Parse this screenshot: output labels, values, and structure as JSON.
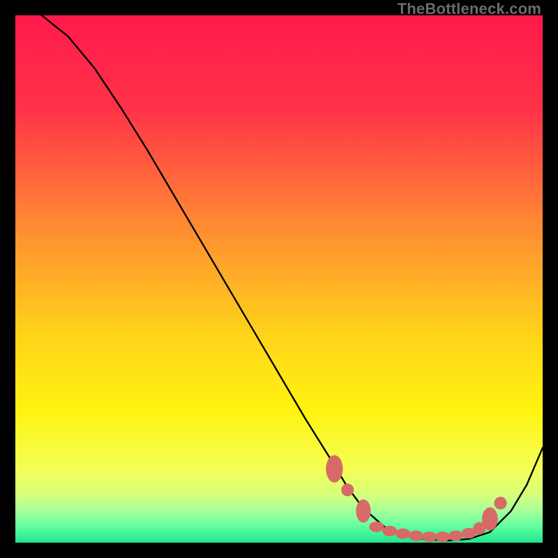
{
  "watermark": "TheBottleneck.com",
  "chart_data": {
    "type": "line",
    "title": "",
    "xlabel": "",
    "ylabel": "",
    "xlim": [
      0,
      100
    ],
    "ylim": [
      0,
      100
    ],
    "gradient_stops": [
      {
        "offset": 0,
        "color": "#ff1a4b"
      },
      {
        "offset": 18,
        "color": "#ff3348"
      },
      {
        "offset": 40,
        "color": "#ff8b33"
      },
      {
        "offset": 60,
        "color": "#ffd21a"
      },
      {
        "offset": 75,
        "color": "#fff310"
      },
      {
        "offset": 86,
        "color": "#f4ff55"
      },
      {
        "offset": 91,
        "color": "#d6ff7d"
      },
      {
        "offset": 94,
        "color": "#a6ff9a"
      },
      {
        "offset": 97,
        "color": "#5effa0"
      },
      {
        "offset": 100,
        "color": "#1fe58e"
      }
    ],
    "series": [
      {
        "name": "bottleneck-curve",
        "x": [
          5,
          10,
          15,
          20,
          25,
          30,
          35,
          40,
          45,
          50,
          55,
          60,
          63,
          66,
          70,
          74,
          78,
          82,
          86,
          90,
          94,
          97,
          100
        ],
        "y": [
          100,
          96,
          90,
          82.5,
          74.5,
          66,
          57.5,
          49,
          40.5,
          32,
          23.5,
          15.5,
          10.5,
          6.5,
          3,
          1.3,
          0.6,
          0.4,
          0.7,
          2,
          6,
          11,
          18
        ]
      }
    ],
    "markers": {
      "name": "highlight-dots",
      "color": "#d76a66",
      "points": [
        {
          "x": 60.5,
          "y": 14.0,
          "rx": 1.6,
          "ry": 2.6
        },
        {
          "x": 63.0,
          "y": 10.0,
          "rx": 1.2,
          "ry": 1.2
        },
        {
          "x": 66.0,
          "y": 6.0,
          "rx": 1.4,
          "ry": 2.2
        },
        {
          "x": 68.5,
          "y": 3.0,
          "rx": 1.4,
          "ry": 1.0
        },
        {
          "x": 71.0,
          "y": 2.2,
          "rx": 1.4,
          "ry": 1.0
        },
        {
          "x": 73.5,
          "y": 1.7,
          "rx": 1.4,
          "ry": 1.0
        },
        {
          "x": 76.0,
          "y": 1.3,
          "rx": 1.4,
          "ry": 1.0
        },
        {
          "x": 78.5,
          "y": 1.1,
          "rx": 1.4,
          "ry": 1.0
        },
        {
          "x": 81.0,
          "y": 1.1,
          "rx": 1.4,
          "ry": 1.0
        },
        {
          "x": 83.5,
          "y": 1.3,
          "rx": 1.4,
          "ry": 1.0
        },
        {
          "x": 86.0,
          "y": 1.8,
          "rx": 1.4,
          "ry": 1.0
        },
        {
          "x": 88.0,
          "y": 2.7,
          "rx": 1.2,
          "ry": 1.2
        },
        {
          "x": 90.0,
          "y": 4.5,
          "rx": 1.5,
          "ry": 2.2
        },
        {
          "x": 92.0,
          "y": 7.5,
          "rx": 1.2,
          "ry": 1.2
        }
      ]
    }
  }
}
